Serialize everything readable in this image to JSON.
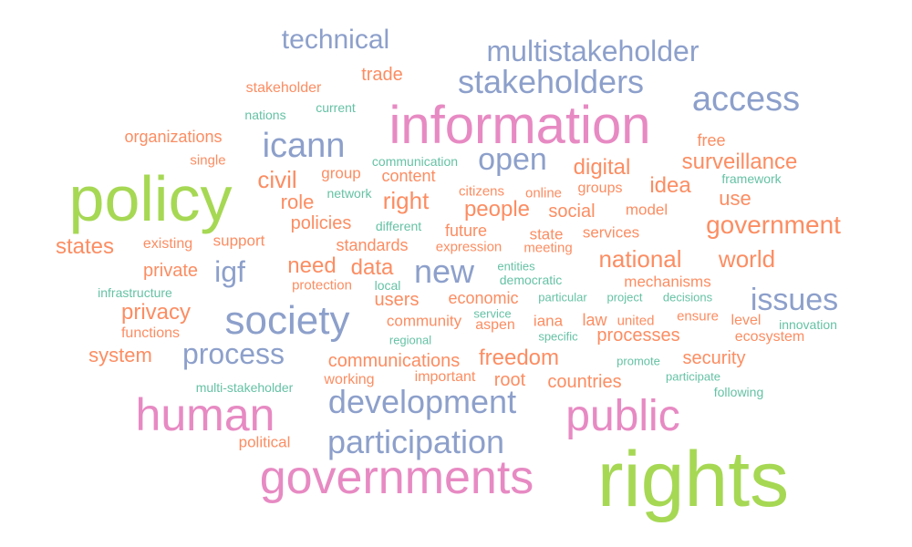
{
  "palette": {
    "green": "#a6d854",
    "pink": "#e78ac3",
    "blue": "#8da0cb",
    "orange": "#fc8d62",
    "teal": "#66c2a5"
  },
  "words": [
    {
      "text": "rights",
      "color": "green"
    },
    {
      "text": "policy",
      "color": "green"
    },
    {
      "text": "information",
      "color": "pink"
    },
    {
      "text": "governments",
      "color": "pink"
    },
    {
      "text": "human",
      "color": "pink"
    },
    {
      "text": "public",
      "color": "pink"
    },
    {
      "text": "society",
      "color": "blue"
    },
    {
      "text": "development",
      "color": "blue"
    },
    {
      "text": "participation",
      "color": "blue"
    },
    {
      "text": "stakeholders",
      "color": "blue"
    },
    {
      "text": "access",
      "color": "blue"
    },
    {
      "text": "icann",
      "color": "blue"
    },
    {
      "text": "multistakeholder",
      "color": "blue"
    },
    {
      "text": "technical",
      "color": "blue"
    },
    {
      "text": "process",
      "color": "blue"
    },
    {
      "text": "new",
      "color": "blue"
    },
    {
      "text": "issues",
      "color": "blue"
    },
    {
      "text": "open",
      "color": "blue"
    },
    {
      "text": "igf",
      "color": "blue"
    },
    {
      "text": "government",
      "color": "orange"
    },
    {
      "text": "national",
      "color": "orange"
    },
    {
      "text": "right",
      "color": "orange"
    },
    {
      "text": "data",
      "color": "orange"
    },
    {
      "text": "need",
      "color": "orange"
    },
    {
      "text": "world",
      "color": "orange"
    },
    {
      "text": "surveillance",
      "color": "orange"
    },
    {
      "text": "freedom",
      "color": "orange"
    },
    {
      "text": "privacy",
      "color": "orange"
    },
    {
      "text": "civil",
      "color": "orange"
    },
    {
      "text": "people",
      "color": "orange"
    },
    {
      "text": "digital",
      "color": "orange"
    },
    {
      "text": "idea",
      "color": "orange"
    },
    {
      "text": "states",
      "color": "orange"
    },
    {
      "text": "communications",
      "color": "orange"
    },
    {
      "text": "security",
      "color": "orange"
    },
    {
      "text": "processes",
      "color": "orange"
    },
    {
      "text": "system",
      "color": "orange"
    },
    {
      "text": "countries",
      "color": "orange"
    },
    {
      "text": "use",
      "color": "orange"
    },
    {
      "text": "policies",
      "color": "orange"
    },
    {
      "text": "users",
      "color": "orange"
    },
    {
      "text": "root",
      "color": "orange"
    },
    {
      "text": "private",
      "color": "orange"
    },
    {
      "text": "role",
      "color": "orange"
    },
    {
      "text": "trade",
      "color": "orange"
    },
    {
      "text": "social",
      "color": "orange"
    },
    {
      "text": "economic",
      "color": "orange"
    },
    {
      "text": "future",
      "color": "orange"
    },
    {
      "text": "free",
      "color": "orange"
    },
    {
      "text": "organizations",
      "color": "orange"
    },
    {
      "text": "content",
      "color": "orange"
    },
    {
      "text": "standards",
      "color": "orange"
    },
    {
      "text": "political",
      "color": "orange"
    },
    {
      "text": "services",
      "color": "orange"
    },
    {
      "text": "state",
      "color": "orange"
    },
    {
      "text": "mechanisms",
      "color": "orange"
    },
    {
      "text": "community",
      "color": "orange"
    },
    {
      "text": "model",
      "color": "orange"
    },
    {
      "text": "group",
      "color": "orange"
    },
    {
      "text": "groups",
      "color": "orange"
    },
    {
      "text": "law",
      "color": "orange"
    },
    {
      "text": "iana",
      "color": "orange"
    },
    {
      "text": "important",
      "color": "orange"
    },
    {
      "text": "ecosystem",
      "color": "orange"
    },
    {
      "text": "support",
      "color": "orange"
    },
    {
      "text": "aspen",
      "color": "orange"
    },
    {
      "text": "level",
      "color": "orange"
    },
    {
      "text": "stakeholder",
      "color": "orange"
    },
    {
      "text": "functions",
      "color": "orange"
    },
    {
      "text": "working",
      "color": "orange"
    },
    {
      "text": "existing",
      "color": "orange"
    },
    {
      "text": "citizens",
      "color": "orange"
    },
    {
      "text": "online",
      "color": "orange"
    },
    {
      "text": "protection",
      "color": "orange"
    },
    {
      "text": "expression",
      "color": "orange"
    },
    {
      "text": "meeting",
      "color": "orange"
    },
    {
      "text": "ensure",
      "color": "orange"
    },
    {
      "text": "united",
      "color": "orange"
    },
    {
      "text": "single",
      "color": "orange"
    },
    {
      "text": "current",
      "color": "teal"
    },
    {
      "text": "nations",
      "color": "teal"
    },
    {
      "text": "communication",
      "color": "teal"
    },
    {
      "text": "network",
      "color": "teal"
    },
    {
      "text": "framework",
      "color": "teal"
    },
    {
      "text": "different",
      "color": "teal"
    },
    {
      "text": "infrastructure",
      "color": "teal"
    },
    {
      "text": "entities",
      "color": "teal"
    },
    {
      "text": "democratic",
      "color": "teal"
    },
    {
      "text": "local",
      "color": "teal"
    },
    {
      "text": "particular",
      "color": "teal"
    },
    {
      "text": "project",
      "color": "teal"
    },
    {
      "text": "decisions",
      "color": "teal"
    },
    {
      "text": "innovation",
      "color": "teal"
    },
    {
      "text": "service",
      "color": "teal"
    },
    {
      "text": "specific",
      "color": "teal"
    },
    {
      "text": "regional",
      "color": "teal"
    },
    {
      "text": "promote",
      "color": "teal"
    },
    {
      "text": "participate",
      "color": "teal"
    },
    {
      "text": "multi-stakeholder",
      "color": "teal"
    },
    {
      "text": "following",
      "color": "teal"
    }
  ]
}
